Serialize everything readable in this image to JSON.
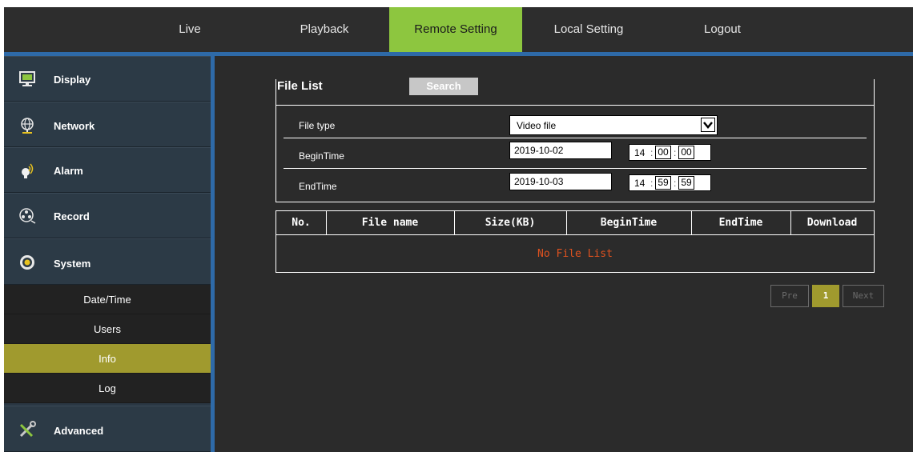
{
  "nav": {
    "items": [
      {
        "label": "Live"
      },
      {
        "label": "Playback"
      },
      {
        "label": "Remote Setting"
      },
      {
        "label": "Local Setting"
      },
      {
        "label": "Logout"
      }
    ],
    "active_color": "#8dc63f"
  },
  "sidebar": {
    "items": [
      {
        "label": "Display",
        "icon": "monitor-icon"
      },
      {
        "label": "Network",
        "icon": "globe-icon"
      },
      {
        "label": "Alarm",
        "icon": "alarm-icon"
      },
      {
        "label": "Record",
        "icon": "record-icon"
      },
      {
        "label": "System",
        "icon": "system-icon"
      },
      {
        "label": "Advanced",
        "icon": "tools-icon"
      }
    ],
    "system_sub": [
      {
        "label": "Date/Time"
      },
      {
        "label": "Users"
      },
      {
        "label": "Info"
      },
      {
        "label": "Log"
      }
    ],
    "active_sub_color": "#a09a2e"
  },
  "filelist": {
    "title": "File List",
    "search_label": "Search",
    "file_type_label": "File type",
    "file_type_value": "Video file",
    "begin_label": "BeginTime",
    "begin_date": "2019-10-02",
    "begin_h": "14",
    "begin_m": "00",
    "begin_s": "00",
    "end_label": "EndTime",
    "end_date": "2019-10-03",
    "end_h": "14",
    "end_m": "59",
    "end_s": "59"
  },
  "table": {
    "columns": [
      "No.",
      "File name",
      "Size(KB)",
      "BeginTime",
      "EndTime",
      "Download"
    ],
    "empty_text": "No File List",
    "empty_color": "#e0521f"
  },
  "pagination": {
    "prev": "Pre",
    "page": "1",
    "next": "Next"
  }
}
